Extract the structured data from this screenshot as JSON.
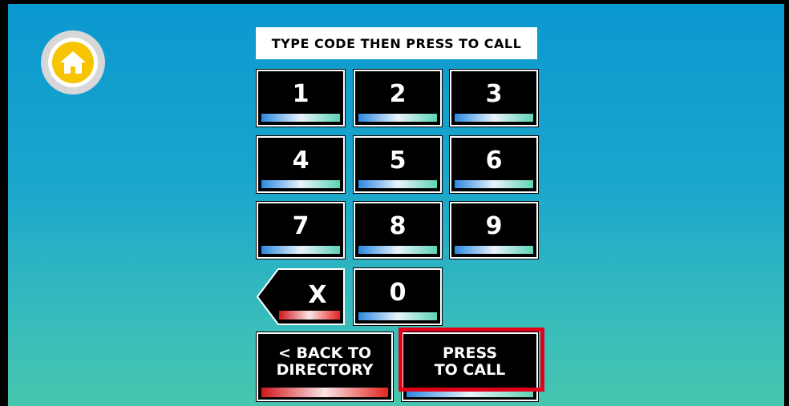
{
  "instruction": "TYPE CODE THEN PRESS TO CALL",
  "keypad": {
    "digits": [
      "1",
      "2",
      "3",
      "4",
      "5",
      "6",
      "7",
      "8",
      "9",
      "0"
    ],
    "clear_label": "X"
  },
  "actions": {
    "back_line1": "< BACK TO",
    "back_line2": "DIRECTORY",
    "call_line1": "PRESS",
    "call_line2": "TO CALL"
  },
  "icons": {
    "home": "home-icon"
  },
  "colors": {
    "background_top": "#0a98d0",
    "background_bottom": "#46c6ae",
    "home_accent": "#f6c400",
    "highlight": "#e3001b"
  }
}
